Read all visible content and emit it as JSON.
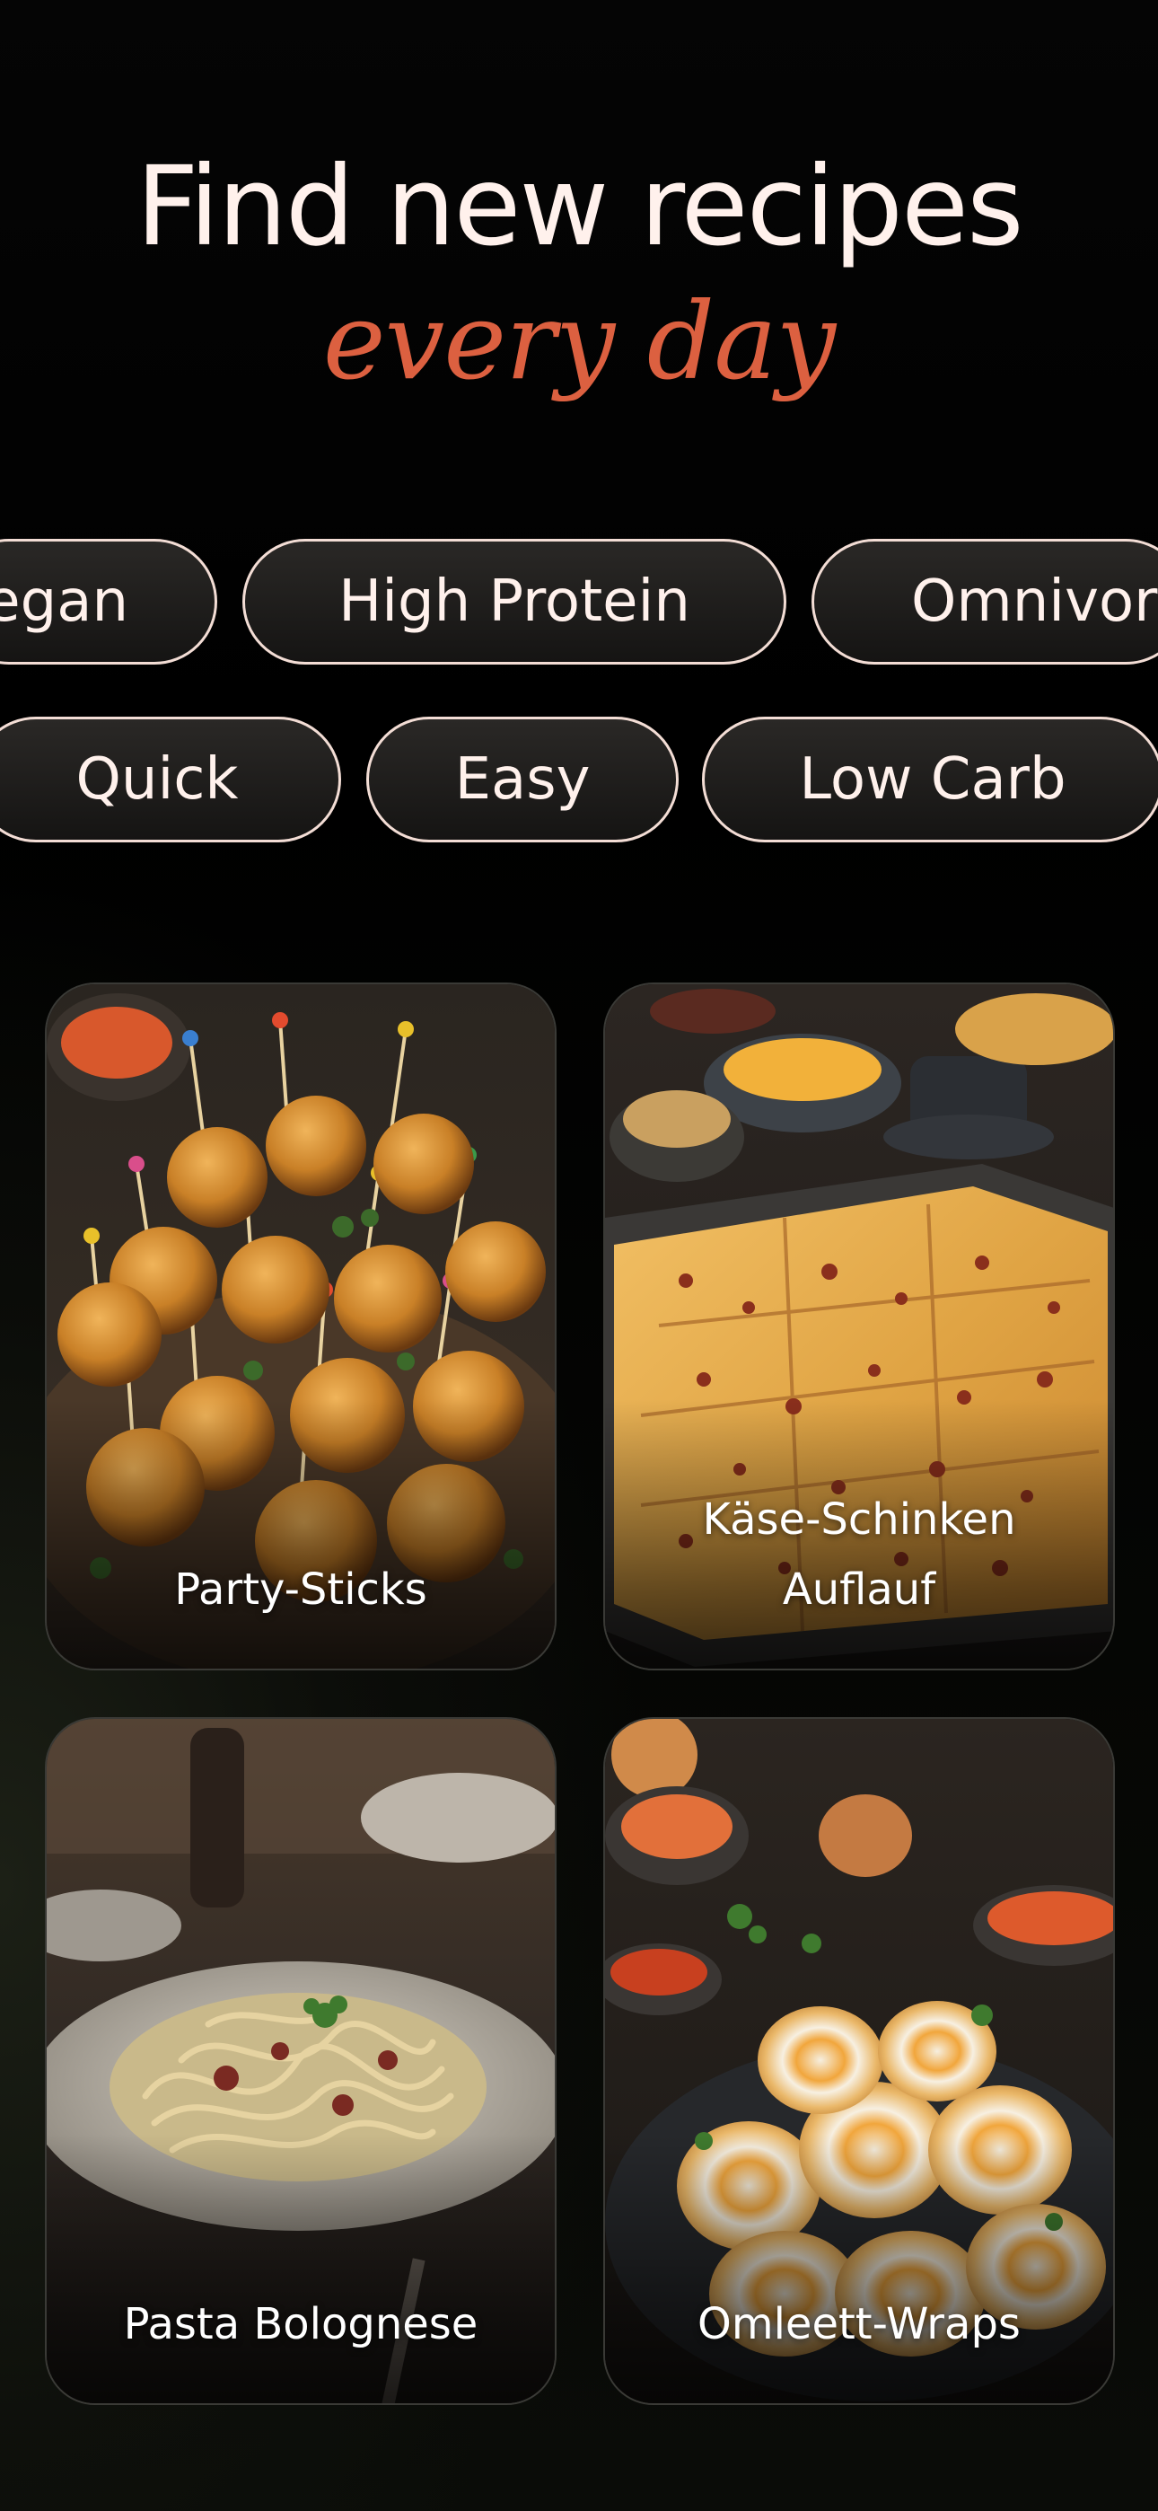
{
  "header": {
    "title": "Find new recipes",
    "subtitle": "every day"
  },
  "filters": {
    "row1": [
      "egan",
      "High Protein",
      "Omnivor"
    ],
    "row2": [
      "Quick",
      "Easy",
      "Low Carb"
    ]
  },
  "recipes": [
    {
      "title": "Party-Sticks",
      "image": "cheese-balls-on-skewers"
    },
    {
      "title_line1": "Käse-Schinken",
      "title_line2": "Auflauf",
      "image": "cheese-ham-casserole"
    },
    {
      "title": "Pasta Bolognese",
      "image": "pasta-plate"
    },
    {
      "title": "Omleett-Wraps",
      "image": "omelette-wraps"
    }
  ],
  "colors": {
    "accent": "#dc6040",
    "title": "#fff1ec",
    "chip_border": "#f3ddd5",
    "background": "#000000"
  }
}
